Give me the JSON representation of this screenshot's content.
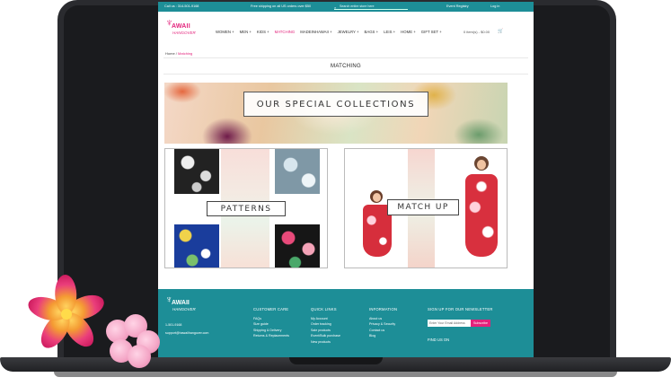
{
  "topbar": {
    "call": "Call us : 314-501-9168",
    "shipping": "Free shipping on all US orders over $50",
    "search_placeholder": "Search entire store here",
    "registry": "Event Registry",
    "login": "Log in"
  },
  "logo": {
    "line1": "AWAII",
    "line2": "HANGOVER"
  },
  "nav": {
    "items": [
      "WOMEN +",
      "MEN +",
      "KIDS +",
      "MATCHING",
      "MADEINHAWAII +",
      "JEWELRY +",
      "BAGS +",
      "LEIS +",
      "HOME +",
      "GIFT SET +"
    ],
    "active_index": 3
  },
  "cart": {
    "label": "0 item(s) - $0.00"
  },
  "breadcrumb": {
    "home": "Home",
    "separator": "/",
    "current": "Matching"
  },
  "page": {
    "title": "MATCHING"
  },
  "banner": {
    "text": "OUR SPECIAL COLLECTIONS"
  },
  "collections": {
    "patterns_label": "PATTERNS",
    "matchup_label": "MATCH UP"
  },
  "footer": {
    "phone": "1-501-9168",
    "email": "support@hawaiihangover.com",
    "customer_care": {
      "title": "CUSTOMER CARE",
      "links": [
        "FAQs",
        "Size guide",
        "Shipping & Delivery",
        "Returns & Replacements"
      ]
    },
    "quick_links": {
      "title": "QUICK LINKS",
      "links": [
        "My Account",
        "Order tracking",
        "Sale products",
        "Event/Bulk purchase",
        "New products"
      ]
    },
    "information": {
      "title": "INFORMATION",
      "links": [
        "About us",
        "Privacy & Security",
        "Contact us",
        "Blog"
      ]
    },
    "newsletter": {
      "title": "SIGN UP FOR OUR NEWSLETTER",
      "placeholder": "Enter Your Email Address",
      "button": "Subscribe"
    },
    "find_us": "FIND US ON"
  },
  "colors": {
    "teal": "#1d8e97",
    "pink": "#e3217b"
  }
}
